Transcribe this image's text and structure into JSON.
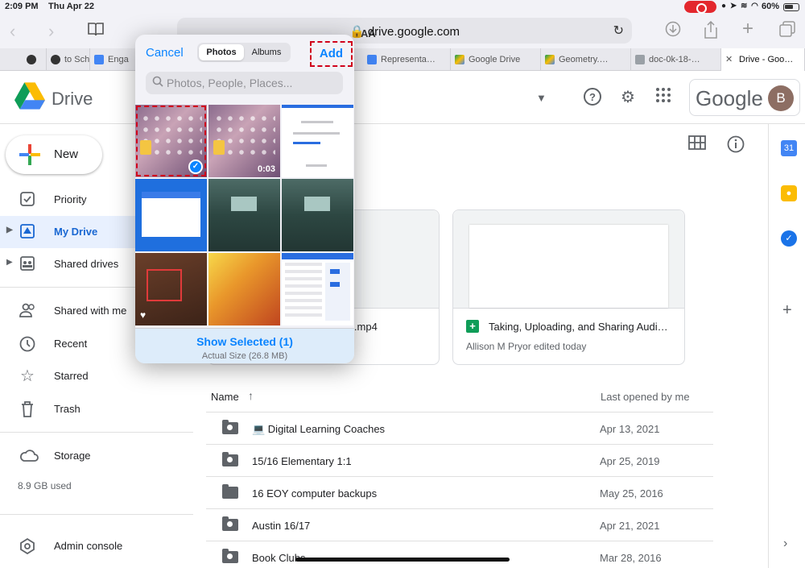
{
  "status": {
    "time": "2:09 PM",
    "date": "Thu Apr 22",
    "battery": "60%"
  },
  "browser": {
    "text_size_label": "AA",
    "url": "drive.google.com",
    "tabs": [
      {
        "label": "",
        "color": "#333333"
      },
      {
        "label": "to Sch",
        "color": "#333333"
      },
      {
        "label": "Enga",
        "color": "#4285f4"
      },
      {
        "label": "Representa…",
        "color": "#4285f4"
      },
      {
        "label": "Google Drive",
        "color": "#fbbc04"
      },
      {
        "label": "Geometry.…",
        "color": "#fbbc04"
      },
      {
        "label": "doc-0k-18-…",
        "color": "#9aa0a6"
      },
      {
        "label": "Drive - Goo…",
        "color": "#ffffff"
      }
    ]
  },
  "drive": {
    "title": "Drive",
    "google_word": "Google",
    "avatar_initial": "B",
    "new_label": "New",
    "nav": [
      {
        "label": "Priority",
        "icon": "checkbox-icon"
      },
      {
        "label": "My Drive",
        "icon": "my-drive-icon"
      },
      {
        "label": "Shared drives",
        "icon": "shared-drives-icon"
      },
      {
        "label": "Shared with me",
        "icon": "people-icon"
      },
      {
        "label": "Recent",
        "icon": "clock-icon"
      },
      {
        "label": "Starred",
        "icon": "star-icon"
      },
      {
        "label": "Trash",
        "icon": "trash-icon"
      },
      {
        "label": "Storage",
        "icon": "cloud-icon"
      }
    ],
    "storage_used": "8.9 GB used",
    "admin_label": "Admin console",
    "cards": [
      {
        "title": "8026.mp4",
        "subtitle": ""
      },
      {
        "title": "Taking, Uploading, and Sharing Audi…",
        "subtitle": "Allison M Pryor edited today"
      }
    ],
    "list": {
      "col_name": "Name",
      "col_date": "Last opened by me",
      "rows": [
        {
          "name": "💻 Digital Learning Coaches",
          "date": "Apr 13, 2021",
          "shared": true
        },
        {
          "name": "15/16 Elementary 1:1",
          "date": "Apr 25, 2019",
          "shared": true
        },
        {
          "name": "16 EOY computer backups",
          "date": "May 25, 2016",
          "shared": false
        },
        {
          "name": "Austin 16/17",
          "date": "Apr 21, 2021",
          "shared": true
        },
        {
          "name": "Book Clubs",
          "date": "Mar 28, 2016",
          "shared": true
        }
      ]
    }
  },
  "picker": {
    "cancel": "Cancel",
    "tab_photos": "Photos",
    "tab_albums": "Albums",
    "add": "Add",
    "search_placeholder": "Photos, People, Places...",
    "video_duration": "0:03",
    "show_selected": "Show Selected (1)",
    "actual_size": "Actual Size (26.8 MB)"
  }
}
